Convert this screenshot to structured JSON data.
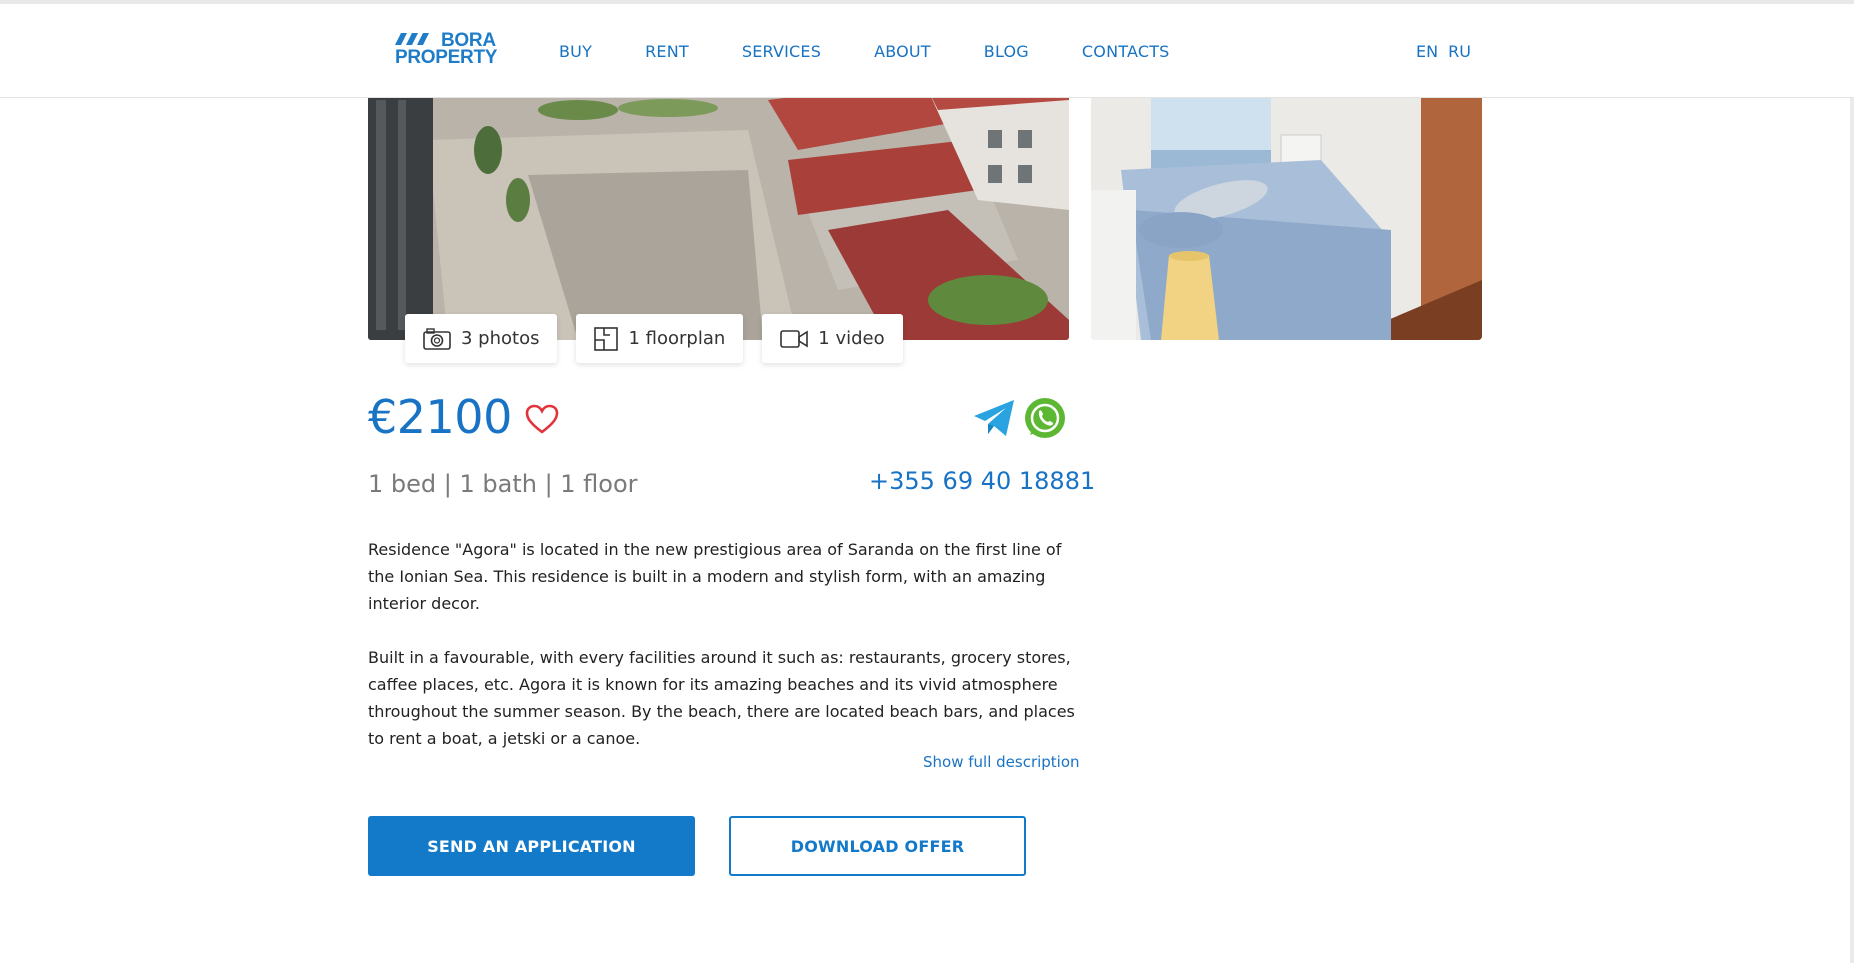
{
  "header": {
    "logo_line1": "BORA",
    "logo_line2": "PROPERTY",
    "nav": [
      "BUY",
      "RENT",
      "SERVICES",
      "ABOUT",
      "BLOG",
      "CONTACTS"
    ],
    "languages": [
      "EN",
      "RU"
    ]
  },
  "media": {
    "photos_label": "3 photos",
    "floorplan_label": "1 floorplan",
    "video_label": "1 video"
  },
  "listing": {
    "price": "€2100",
    "specs": "1 bed | 1 bath | 1 floor",
    "phone": "+355 69 40 18881",
    "description": [
      "Residence \"Agora\" is located in the new prestigious area of Saranda on the first line of the Ionian Sea. This residence is built in a modern and stylish form, with an amazing interior decor.",
      "Built in a favourable, with every facilities around it such as: restaurants, grocery stores, caffee places, etc. Agora it is known for its amazing beaches and its vivid atmosphere throughout the summer season. By the beach, there are located beach bars, and places to rent a boat, a jetski or a canoe."
    ],
    "show_full": "Show full description"
  },
  "actions": {
    "apply_label": "SEND AN APPLICATION",
    "download_label": "DOWNLOAD OFFER"
  },
  "colors": {
    "brand": "#1873c5",
    "button": "#1379c9",
    "heart": "#e0343a",
    "telegram": "#2aa3e0",
    "whatsapp": "#5cb833"
  }
}
